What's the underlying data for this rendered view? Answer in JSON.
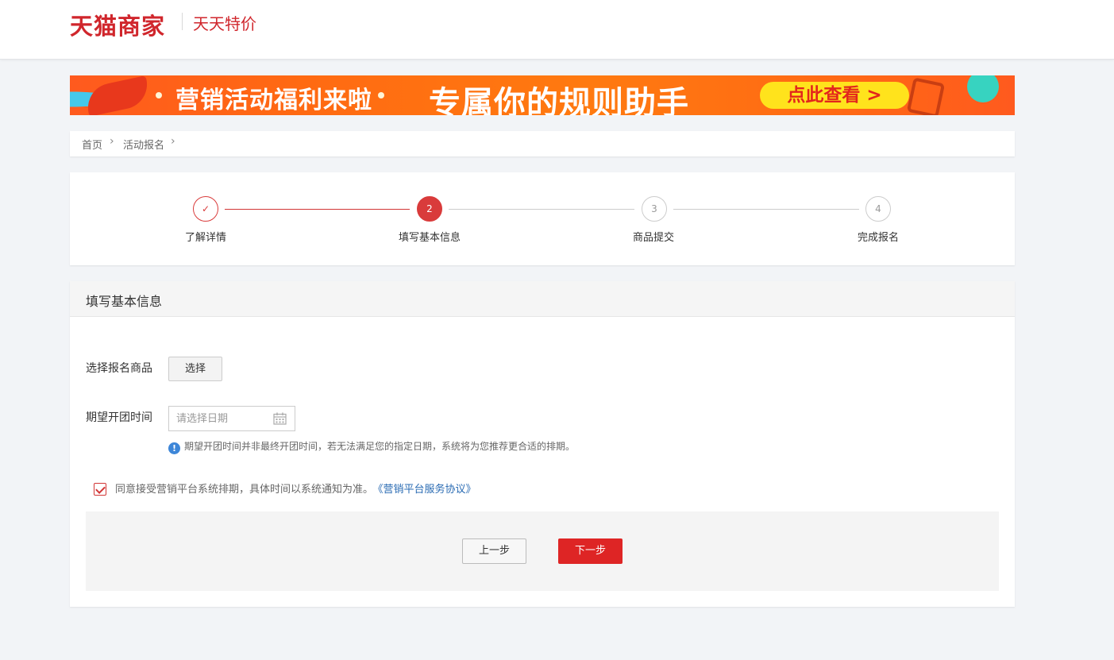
{
  "header": {
    "logo": "天猫商家",
    "subtitle": "天天特价"
  },
  "banner": {
    "text_left": "营销活动福利来啦",
    "text_main": "专属你的规则助手",
    "cta_label": "点此查看 >"
  },
  "breadcrumb": {
    "items": [
      "首页",
      "活动报名"
    ],
    "separator": "›"
  },
  "steps": {
    "items": [
      {
        "number": "✓",
        "label": "了解详情",
        "state": "done"
      },
      {
        "number": "2",
        "label": "填写基本信息",
        "state": "active"
      },
      {
        "number": "3",
        "label": "商品提交",
        "state": "pending"
      },
      {
        "number": "4",
        "label": "完成报名",
        "state": "pending"
      }
    ]
  },
  "form": {
    "title": "填写基本信息",
    "product": {
      "label": "选择报名商品",
      "button_label": "选择"
    },
    "date": {
      "label": "期望开团时间",
      "placeholder": "请选择日期",
      "value": ""
    },
    "hint": {
      "icon": "!",
      "text": "期望开团时间并非最终开团时间，若无法满足您的指定日期，系统将为您推荐更合适的排期。"
    },
    "agreement": {
      "checked": true,
      "text": "同意接受营销平台系统排期，具体时间以系统通知为准。",
      "link_label": "《营销平台服务协议》"
    },
    "actions": {
      "prev_label": "上一步",
      "next_label": "下一步"
    }
  },
  "colors": {
    "brand": "#d0262c",
    "active_step": "#d93b3b",
    "primary_button": "#de2525",
    "link": "#2a6bb3",
    "info": "#3d86d8"
  }
}
